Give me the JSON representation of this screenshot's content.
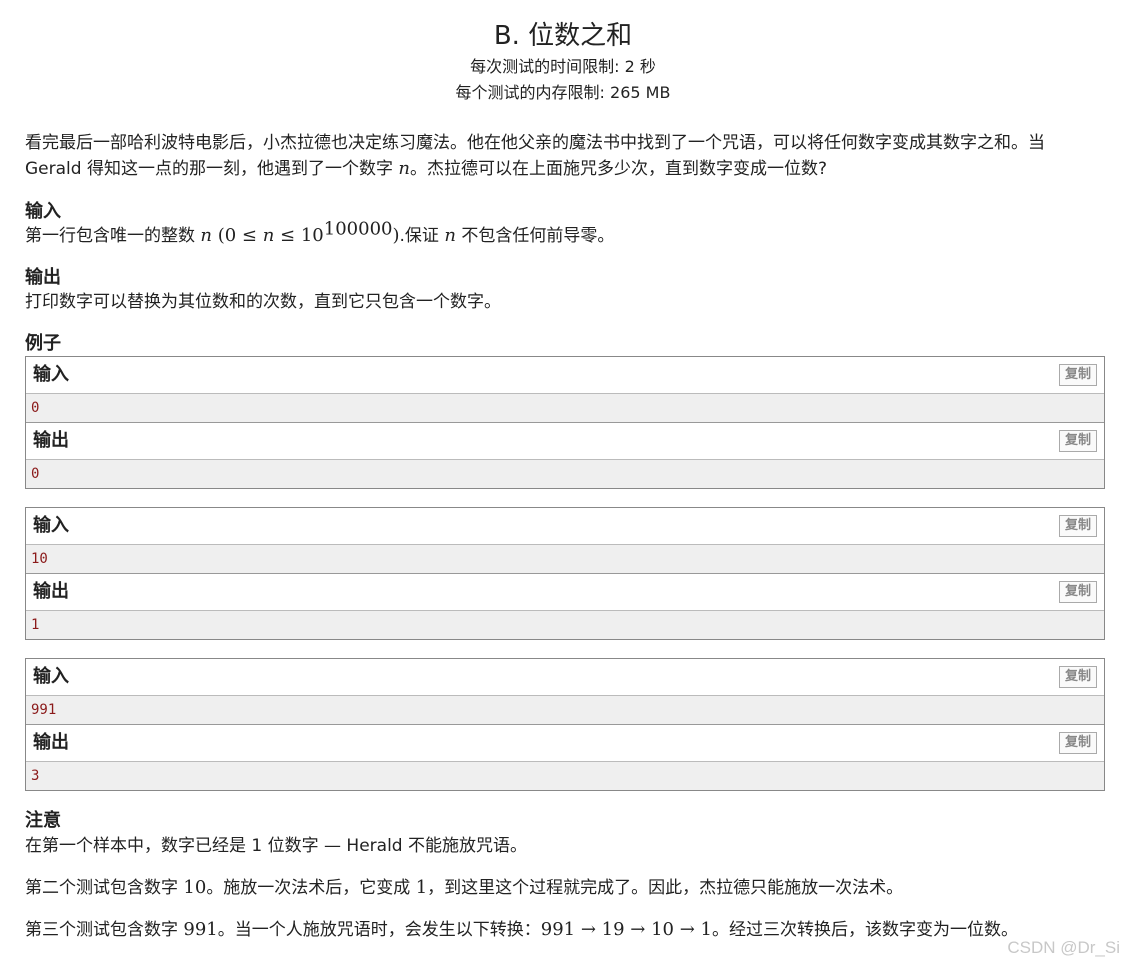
{
  "problem": {
    "title": "B. 位数之和",
    "time_limit": "每次测试的时间限制: 2 秒",
    "memory_limit": "每个测试的内存限制: 265 MB"
  },
  "legend": {
    "part1": "看完最后一部哈利波特电影后，小杰拉德也决定练习魔法。他在他父亲的魔法书中找到了一个咒语，可以将任何数字变成其数字之和。当 Gerald 得知这一点的那一刻，他遇到了一个数字 ",
    "var": "n",
    "part2": "。杰拉德可以在上面施咒多少次，直到数字变成一位数?"
  },
  "input_section": {
    "title": "输入",
    "text1": "第一行包含唯一的整数 ",
    "var": "n",
    "range_open": " (0 ≤ ",
    "range_mid": " ≤ 10",
    "exp": "100000",
    "range_close": ")",
    "text2": ".保证 ",
    "text3": " 不包含任何前导零。"
  },
  "output_section": {
    "title": "输出",
    "text": "打印数字可以替换为其位数和的次数，直到它只包含一个数字。"
  },
  "examples": {
    "title": "例子",
    "input_label": "输入",
    "output_label": "输出",
    "copy_label": "复制",
    "tests": [
      {
        "input": "0",
        "output": "0"
      },
      {
        "input": "10",
        "output": "1"
      },
      {
        "input": "991",
        "output": "3"
      }
    ]
  },
  "note": {
    "title": "注意",
    "p1": "在第一个样本中，数字已经是 1 位数字 — Herald 不能施放咒语。",
    "p2_a": "第二个测试包含数字 ",
    "p2_n1": "10",
    "p2_b": "。施放一次法术后，它变成 ",
    "p2_n2": "1",
    "p2_c": "，到这里这个过程就完成了。因此，杰拉德只能施放一次法术。",
    "p3_a": "第三个测试包含数字 ",
    "p3_n1": "991",
    "p3_b": "。当一个人施放咒语时，会发生以下转换：",
    "p3_chain": "991 → 19 → 10 → 1",
    "p3_c": "。经过三次转换后，该数字变为一位数。"
  },
  "watermark": "CSDN @Dr_Si"
}
